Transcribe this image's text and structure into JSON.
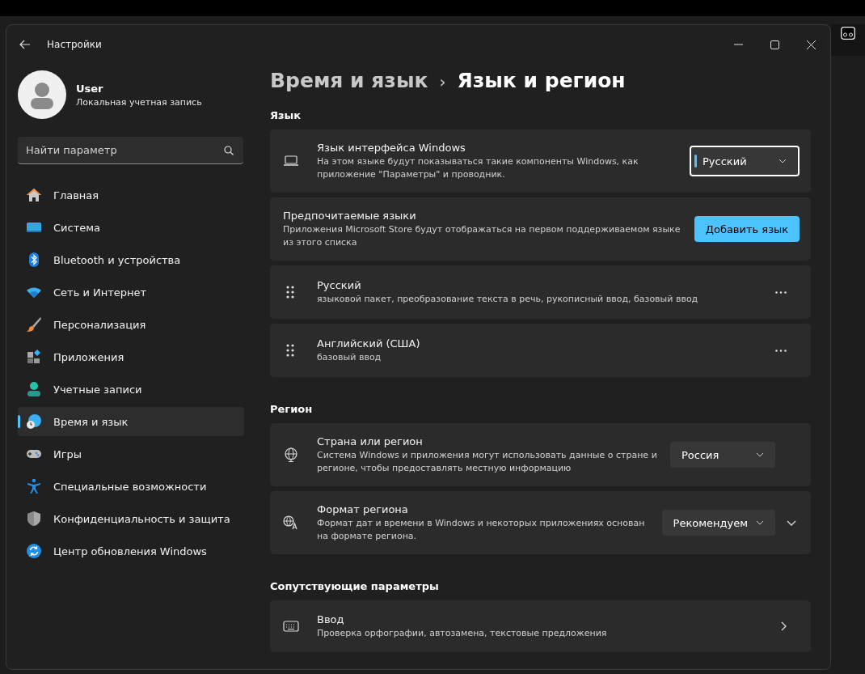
{
  "window": {
    "title": "Настройки"
  },
  "user": {
    "name": "User",
    "account": "Локальная учетная запись"
  },
  "search": {
    "placeholder": "Найти параметр"
  },
  "nav": [
    {
      "label": "Главная",
      "selected": false
    },
    {
      "label": "Система",
      "selected": false
    },
    {
      "label": "Bluetooth и устройства",
      "selected": false
    },
    {
      "label": "Сеть и Интернет",
      "selected": false
    },
    {
      "label": "Персонализация",
      "selected": false
    },
    {
      "label": "Приложения",
      "selected": false
    },
    {
      "label": "Учетные записи",
      "selected": false
    },
    {
      "label": "Время и язык",
      "selected": true
    },
    {
      "label": "Игры",
      "selected": false
    },
    {
      "label": "Специальные возможности",
      "selected": false
    },
    {
      "label": "Конфиденциальность и защита",
      "selected": false
    },
    {
      "label": "Центр обновления Windows",
      "selected": false
    }
  ],
  "breadcrumb": {
    "parent": "Время и язык",
    "separator": "›",
    "current": "Язык и регион"
  },
  "sections": [
    {
      "title": "Язык",
      "cards": [
        {
          "kind": "dropdown",
          "title": "Язык интерфейса Windows",
          "description": "На этом языке будут показываться такие компоненты Windows, как приложение \"Параметры\" и проводник.",
          "value": "Русский",
          "focused": true,
          "expandable": false
        },
        {
          "kind": "button",
          "title": "Предпочитаемые языки",
          "description": "Приложения Microsoft Store будут отображаться на первом поддерживаемом языке из этого списка",
          "button": "Добавить язык"
        },
        {
          "kind": "language",
          "title": "Русский",
          "description": "языковой пакет, преобразование текста в речь, рукописный ввод, базовый ввод"
        },
        {
          "kind": "language",
          "title": "Английский (США)",
          "description": "базовый ввод"
        }
      ]
    },
    {
      "title": "Регион",
      "cards": [
        {
          "kind": "dropdown",
          "title": "Страна или регион",
          "description": "Система Windows и приложения могут использовать данные о стране и регионе, чтобы предоставлять местную информацию",
          "value": "Россия",
          "focused": false,
          "expandable": false
        },
        {
          "kind": "dropdown",
          "title": "Формат региона",
          "description": "Формат дат и времени в Windows и некоторых приложениях основан на формате региона.",
          "value": "Рекомендуем",
          "focused": false,
          "expandable": true
        }
      ]
    },
    {
      "title": "Сопутствующие параметры",
      "cards": [
        {
          "kind": "link",
          "title": "Ввод",
          "description": "Проверка орфографии, автозамена, текстовые предложения"
        }
      ]
    }
  ]
}
